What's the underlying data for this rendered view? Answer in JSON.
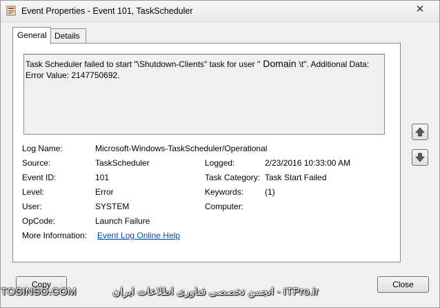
{
  "window": {
    "title": "Event Properties - Event 101, TaskScheduler",
    "close_glyph": "✕"
  },
  "tabs": [
    {
      "label": "General",
      "active": true
    },
    {
      "label": "Details",
      "active": false
    }
  ],
  "description": {
    "line1_before": "Task Scheduler failed to start \"\\Shutdown-Clients\" task for user \"",
    "line1_domain": "Domain",
    "line1_after": "\\t\". Additional Data:",
    "line2": "Error Value: 2147750692."
  },
  "fields": {
    "log_name": {
      "label": "Log Name:",
      "value": "Microsoft-Windows-TaskScheduler/Operational"
    },
    "source": {
      "label": "Source:",
      "value": "TaskScheduler"
    },
    "logged": {
      "label": "Logged:",
      "value": "2/23/2016 10:33:00 AM"
    },
    "event_id": {
      "label": "Event ID:",
      "value": "101"
    },
    "task_category": {
      "label": "Task Category:",
      "value": "Task Start Failed"
    },
    "level": {
      "label": "Level:",
      "value": "Error"
    },
    "keywords": {
      "label": "Keywords:",
      "value": "(1)"
    },
    "user": {
      "label": "User:",
      "value": "SYSTEM"
    },
    "computer": {
      "label": "Computer:",
      "value": ""
    },
    "opcode": {
      "label": "OpCode:",
      "value": "Launch Failure"
    },
    "more_info": {
      "label": "More Information:",
      "value": "Event Log Online Help"
    }
  },
  "buttons": {
    "copy": "Copy",
    "close": "Close"
  },
  "watermark": {
    "left": "TOSINSO.COM",
    "right": "انجمن تخصصی فناوری اطلاعات ایران - ITPro.ir"
  },
  "icons": {
    "app": "event-viewer-icon",
    "up": "arrow-up-icon",
    "down": "arrow-down-icon"
  }
}
